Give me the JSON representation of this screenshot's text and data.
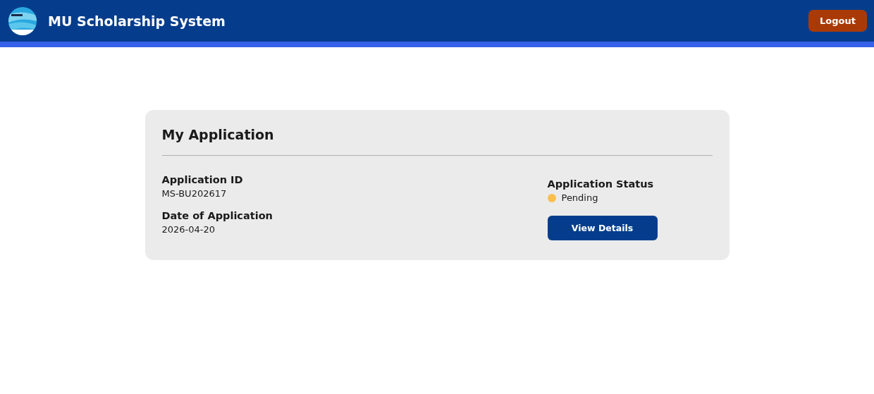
{
  "header": {
    "title": "MU Scholarship System",
    "logout": "Logout"
  },
  "card": {
    "title": "My Application",
    "fields": [
      {
        "label": "Application ID",
        "value": "MS-BU202617"
      },
      {
        "label": "Date of Application",
        "value": "2026-04-20"
      }
    ],
    "status": {
      "label": "Application Status",
      "value": "Pending",
      "color": "#fbbf50"
    },
    "button": "View Details"
  }
}
